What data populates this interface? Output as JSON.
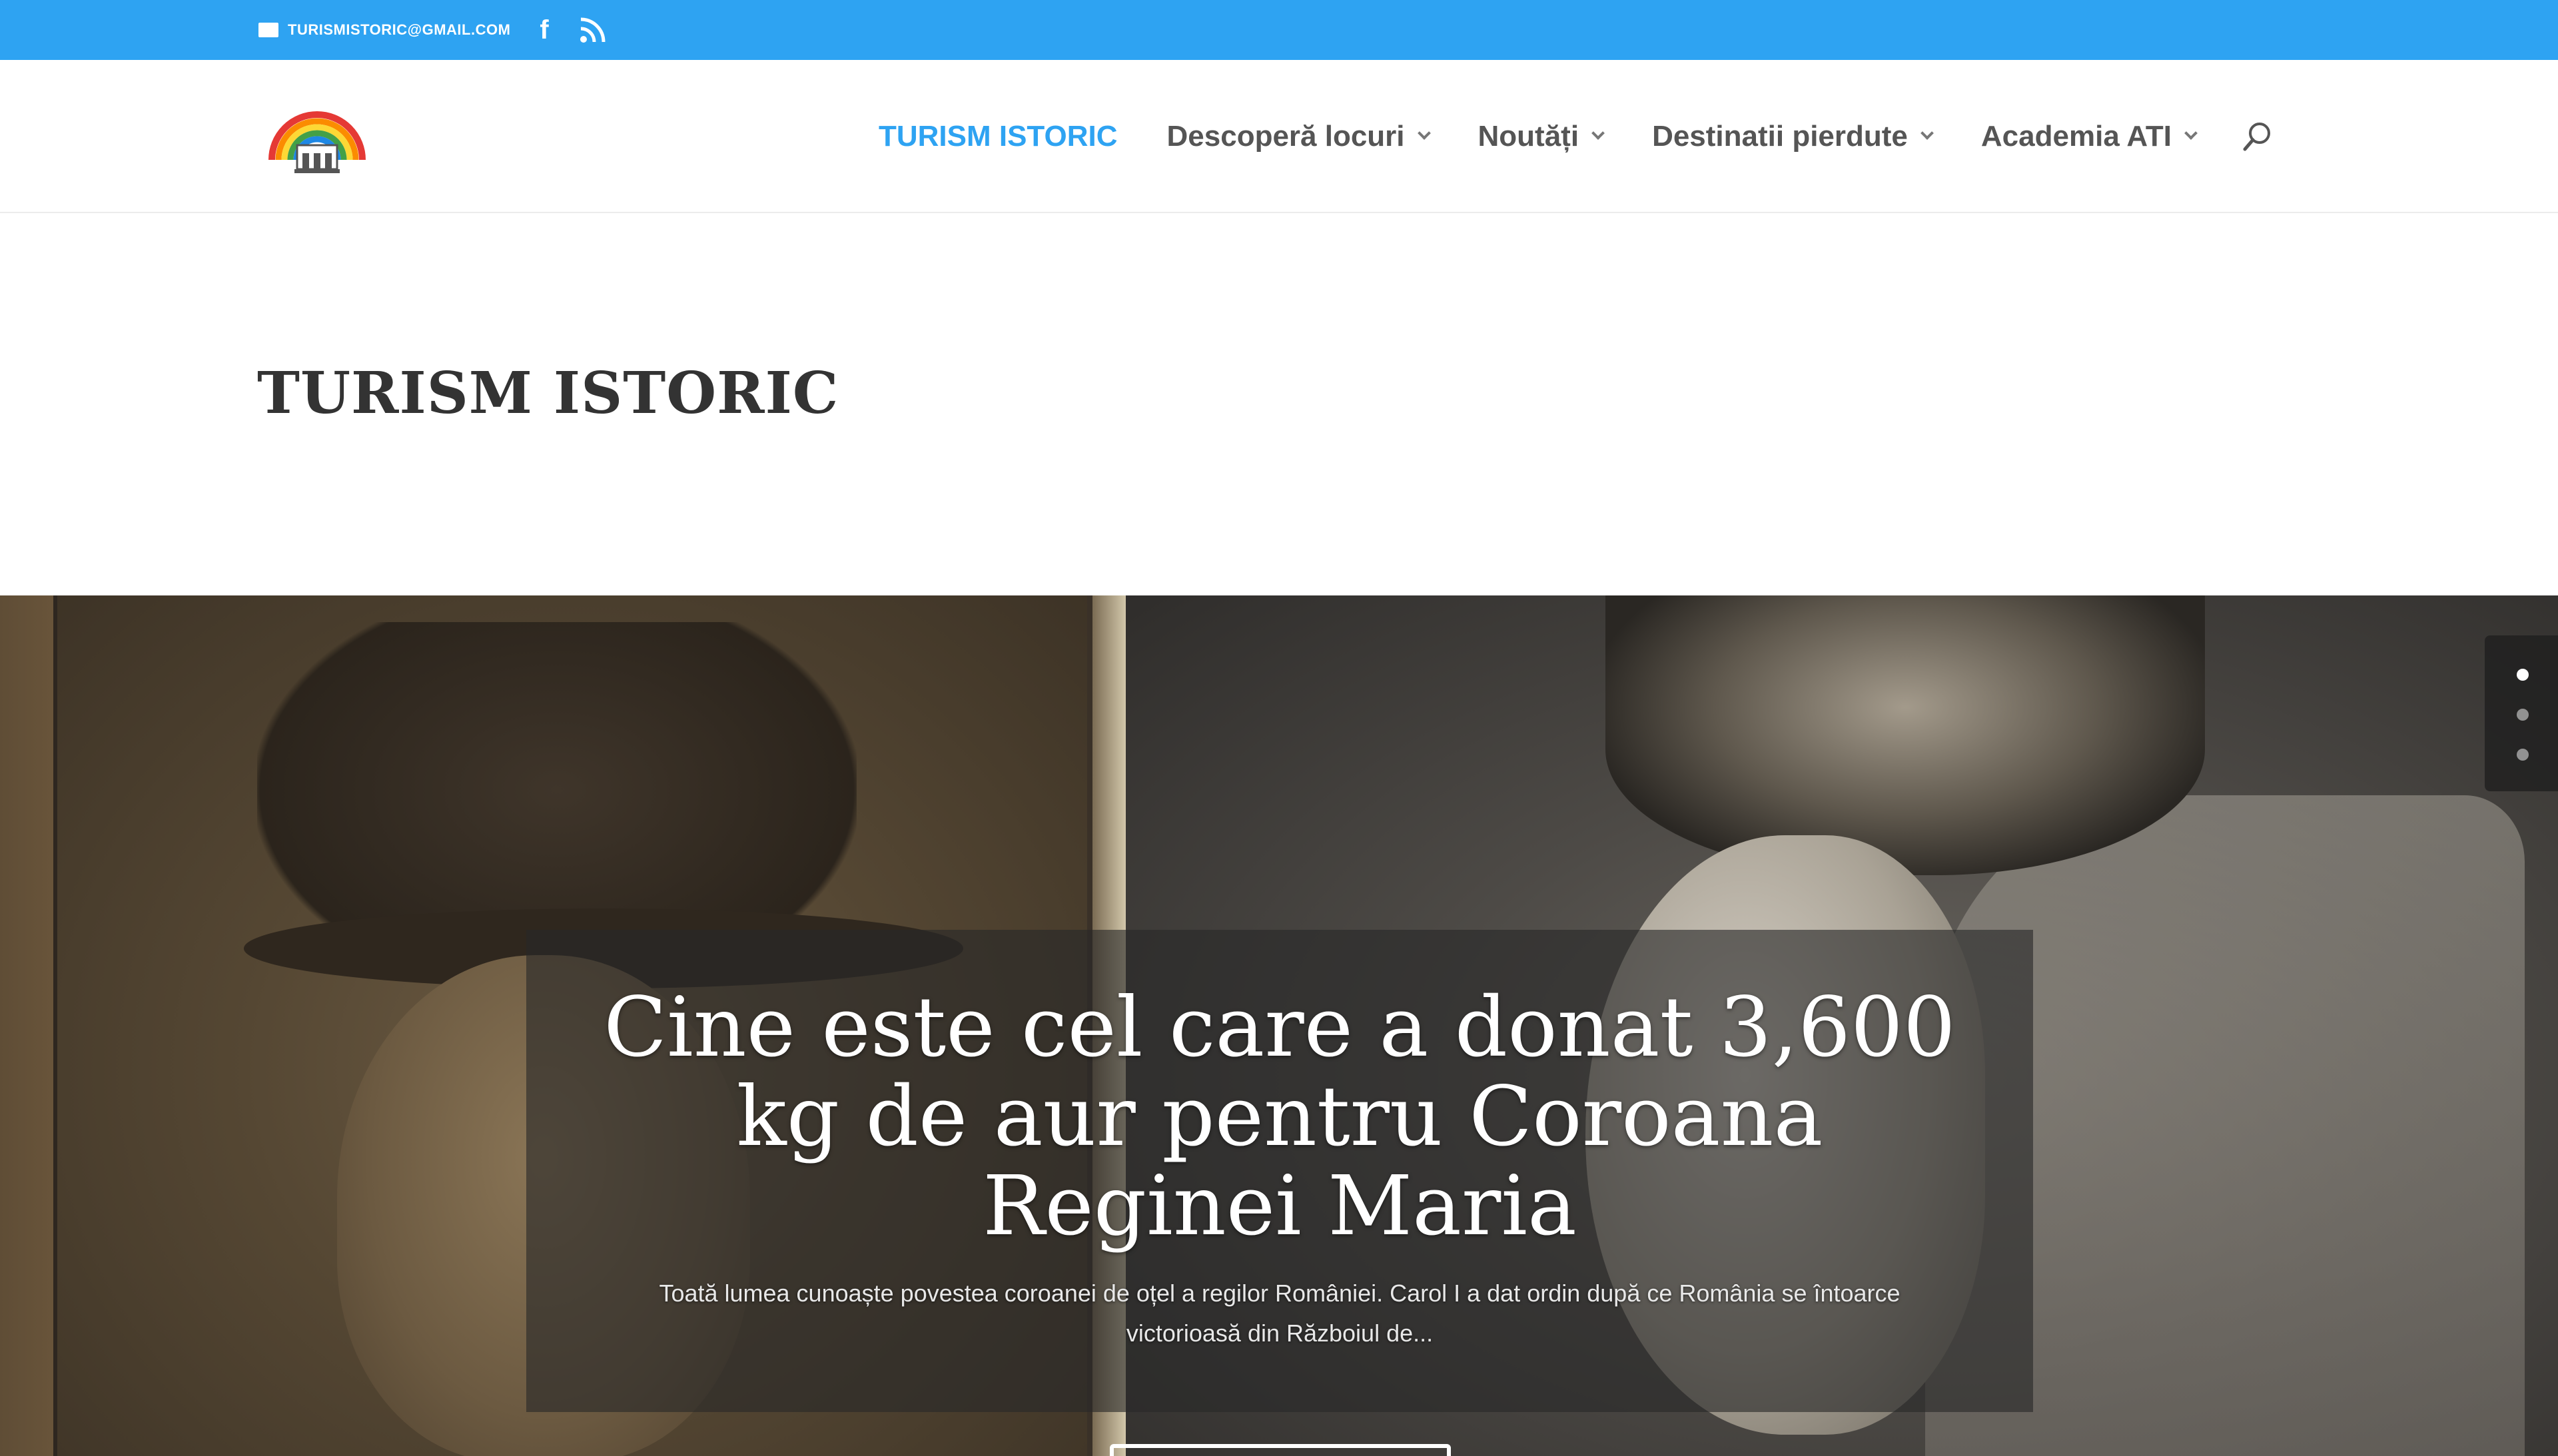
{
  "topbar": {
    "email": "TURISMISTORIC@GMAIL.COM",
    "icons": [
      "mail-icon",
      "facebook-icon",
      "rss-icon"
    ]
  },
  "header": {
    "logo_alt": "Turism Istoric logo",
    "nav": [
      {
        "label": "TURISM ISTORIC",
        "active": true,
        "dropdown": false
      },
      {
        "label": "Descoperă locuri",
        "active": false,
        "dropdown": true
      },
      {
        "label": "Noutăți",
        "active": false,
        "dropdown": true
      },
      {
        "label": "Destinatii pierdute",
        "active": false,
        "dropdown": true
      },
      {
        "label": "Academia ATI",
        "active": false,
        "dropdown": true
      }
    ],
    "search_icon": "search-icon"
  },
  "page": {
    "title": "TURISM ISTORIC"
  },
  "slider": {
    "title": "Cine este cel care a donat 3,600 kg de aur pentru Coroana Reginei Maria",
    "excerpt": "Toată lumea cunoaște povestea coroanei de oțel a regilor României. Carol I a dat ordin după ce România se întoarce victorioasă din Războiul de...",
    "slide_count": 3,
    "active_slide": 1
  },
  "colors": {
    "accent": "#2ea3f2",
    "nav_text": "#555555",
    "title_text": "#333333"
  }
}
